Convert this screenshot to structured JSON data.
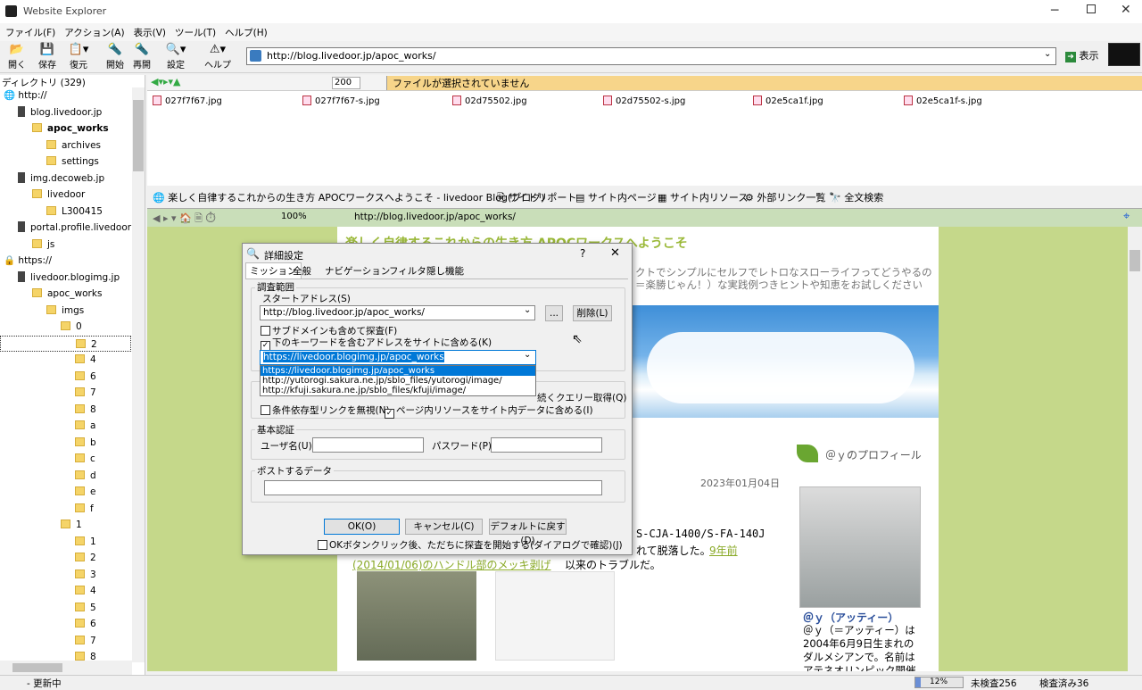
{
  "app": {
    "title": "Website Explorer"
  },
  "menu": [
    "ファイル(F)",
    "アクション(A)",
    "表示(V)",
    "ツール(T)",
    "ヘルプ(H)"
  ],
  "toolbar": {
    "open": "開く",
    "save": "保存",
    "restore": "復元",
    "start": "開始",
    "resume": "再開",
    "settings": "設定",
    "help": "ヘルプ",
    "go": "表示"
  },
  "address": "http://blog.livedoor.jp/apoc_works/",
  "sidebar": {
    "header": "ディレクトリ (329)",
    "items": [
      {
        "label": "http://",
        "kind": "globe"
      },
      {
        "label": "blog.livedoor.jp",
        "kind": "server"
      },
      {
        "label": "apoc_works",
        "kind": "folder",
        "bold": true
      },
      {
        "label": "archives",
        "kind": "folder"
      },
      {
        "label": "settings",
        "kind": "folder"
      },
      {
        "label": "img.decoweb.jp",
        "kind": "server"
      },
      {
        "label": "livedoor",
        "kind": "folder"
      },
      {
        "label": "L300415",
        "kind": "folder"
      },
      {
        "label": "portal.profile.livedoor",
        "kind": "server"
      },
      {
        "label": "js",
        "kind": "folder"
      },
      {
        "label": "https://",
        "kind": "lock"
      },
      {
        "label": "livedoor.blogimg.jp",
        "kind": "server"
      },
      {
        "label": "apoc_works",
        "kind": "folder"
      },
      {
        "label": "imgs",
        "kind": "folder"
      },
      {
        "label": "0",
        "kind": "folder"
      },
      {
        "label": "2",
        "kind": "folder",
        "selected": true
      },
      {
        "label": "4",
        "kind": "folder"
      },
      {
        "label": "6",
        "kind": "folder"
      },
      {
        "label": "7",
        "kind": "folder"
      },
      {
        "label": "8",
        "kind": "folder"
      },
      {
        "label": "a",
        "kind": "folder"
      },
      {
        "label": "b",
        "kind": "folder"
      },
      {
        "label": "c",
        "kind": "folder"
      },
      {
        "label": "d",
        "kind": "folder"
      },
      {
        "label": "e",
        "kind": "folder"
      },
      {
        "label": "f",
        "kind": "folder"
      },
      {
        "label": "1",
        "kind": "folder"
      },
      {
        "label": "1",
        "kind": "folder"
      },
      {
        "label": "2",
        "kind": "folder"
      },
      {
        "label": "3",
        "kind": "folder"
      },
      {
        "label": "4",
        "kind": "folder"
      },
      {
        "label": "5",
        "kind": "folder"
      },
      {
        "label": "6",
        "kind": "folder"
      },
      {
        "label": "7",
        "kind": "folder"
      },
      {
        "label": "8",
        "kind": "folder"
      }
    ]
  },
  "filebar": {
    "count": "200",
    "message": "ファイルが選択されていません"
  },
  "files": [
    "027f7f67.jpg",
    "027f7f67-s.jpg",
    "02d75502.jpg",
    "02d75502-s.jpg",
    "02e5ca1f.jpg",
    "02e5ca1f-s.jpg"
  ],
  "tabs": [
    "楽しく自律するこれからの生き方 APOCワークスへようこそ - livedoor Blog(ブログ)",
    "サイトリポート",
    "サイト内ページ",
    "サイト内リソース",
    "外部リンク一覧",
    "全文検索"
  ],
  "nav": {
    "zoom": "100%",
    "url": "http://blog.livedoor.jp/apoc_works/"
  },
  "web": {
    "blog_title": "楽しく自律するこれからの生き方 APOCワークスへようこそ",
    "desc1": "クトでシンプルにセルフでレトロなスローライフってどうやるの",
    "desc2": "＝楽勝じゃん！）な実践例つきヒントや知恵をお試しください",
    "date": "2023年01月04日",
    "profile_head": "＠ｙのプロフィール",
    "text1": "S-CJA-1400/S-FA-140J",
    "text2": "れて脱落した。",
    "link1": "9年前",
    "link2": "(2014/01/06)のハンドル部のメッキ剥げ",
    "text3": "以来のトラブルだ。",
    "profile_name": "＠ｙ（アッティー）",
    "profile_text": [
      "＠ｙ（＝アッティー）は",
      "2004年6月9日生まれの",
      "ダルメシアンで。名前は",
      "アテネオリンピック開催"
    ]
  },
  "dialog": {
    "title": "詳細設定",
    "help": "?",
    "close": "✕",
    "tabs": [
      "ミッション",
      "全般",
      "ナビゲーション",
      "フィルタ",
      "隠し機能"
    ],
    "group_scope": "調査範囲",
    "start_label": "スタートアドレス(S)",
    "start_value": "http://blog.livedoor.jp/apoc_works/",
    "browse": "...",
    "delete": "削除(L)",
    "cb_subdomain": "サブドメインも含めて探査(F)",
    "cb_keyword": "下のキーワードを含むアドレスをサイトに含める(K)",
    "keyword_value": "https://livedoor.blogimg.jp/apoc_works",
    "options": [
      "https://livedoor.blogimg.jp/apoc_works",
      "http://yutorogi.sakura.ne.jp/sblo_files/yutorogi/image/",
      "http://kfuji.sakura.ne.jp/sblo_files/kfuji/image/"
    ],
    "cb_query": "続くクエリー取得(Q)",
    "cb_condlink": "条件依存型リンクを無視(N)",
    "cb_resource": "ページ内リソースをサイト内データに含める(I)",
    "group_auth": "基本認証",
    "user_label": "ユーザ名(U)",
    "pass_label": "パスワード(P)",
    "group_post": "ポストするデータ",
    "ok": "OK(O)",
    "cancel": "キャンセル(C)",
    "default": "デフォルトに戻す(D)",
    "cb_start": "OKボタンクリック後、ただちに探査を開始する(ダイアログで確認)(J)"
  },
  "status": {
    "text": "- 更新中",
    "progress": "12%",
    "progress_value": 0.12,
    "unchecked": "未検査256",
    "checked": "検査済み36"
  }
}
